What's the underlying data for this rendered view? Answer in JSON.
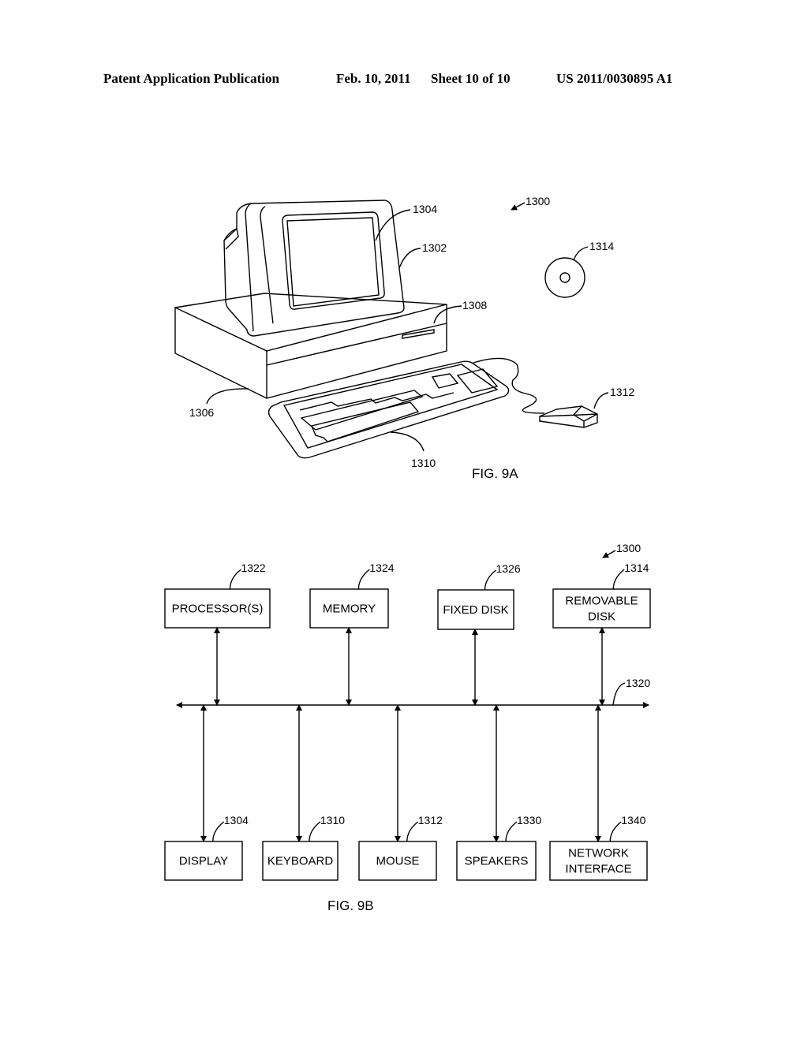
{
  "header": {
    "publication": "Patent Application Publication",
    "date": "Feb. 10, 2011",
    "sheet": "Sheet 10 of 10",
    "number": "US 2011/0030895 A1"
  },
  "fig9a": {
    "caption": "FIG. 9A",
    "refs": {
      "system": "1300",
      "display": "1304",
      "monitor": "1302",
      "drive_slot": "1308",
      "base": "1306",
      "keyboard": "1310",
      "disk": "1314",
      "mouse": "1312"
    }
  },
  "fig9b": {
    "caption": "FIG. 9B",
    "system_ref": "1300",
    "bus_ref": "1320",
    "top_boxes": [
      {
        "label": [
          "PROCESSOR(S)"
        ],
        "ref": "1322"
      },
      {
        "label": [
          "MEMORY"
        ],
        "ref": "1324"
      },
      {
        "label": [
          "FIXED DISK"
        ],
        "ref": "1326"
      },
      {
        "label": [
          "REMOVABLE",
          "DISK"
        ],
        "ref": "1314"
      }
    ],
    "bottom_boxes": [
      {
        "label": [
          "DISPLAY"
        ],
        "ref": "1304"
      },
      {
        "label": [
          "KEYBOARD"
        ],
        "ref": "1310"
      },
      {
        "label": [
          "MOUSE"
        ],
        "ref": "1312"
      },
      {
        "label": [
          "SPEAKERS"
        ],
        "ref": "1330"
      },
      {
        "label": [
          "NETWORK",
          "INTERFACE"
        ],
        "ref": "1340"
      }
    ]
  }
}
